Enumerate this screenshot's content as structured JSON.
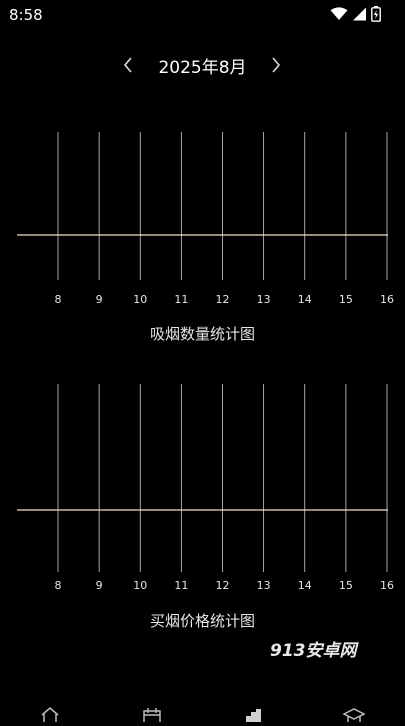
{
  "status": {
    "time": "8:58"
  },
  "header": {
    "month_title": "2025年8月"
  },
  "charts": [
    {
      "title": "吸烟数量统计图",
      "line_color": "#f2e0c8",
      "grid_color": "#cfcfcf",
      "ticks": [
        "8",
        "9",
        "10",
        "11",
        "12",
        "13",
        "14",
        "15",
        "16"
      ]
    },
    {
      "title": "买烟价格统计图",
      "line_color": "#f2e0c8",
      "grid_color": "#cfcfcf",
      "ticks": [
        "8",
        "9",
        "10",
        "11",
        "12",
        "13",
        "14",
        "15",
        "16"
      ]
    }
  ],
  "chart_data": [
    {
      "type": "line",
      "title": "吸烟数量统计图",
      "categories": [
        "8",
        "9",
        "10",
        "11",
        "12",
        "13",
        "14",
        "15",
        "16"
      ],
      "values": [
        0,
        0,
        0,
        0,
        0,
        0,
        0,
        0,
        0
      ],
      "grid": true
    },
    {
      "type": "line",
      "title": "买烟价格统计图",
      "categories": [
        "8",
        "9",
        "10",
        "11",
        "12",
        "13",
        "14",
        "15",
        "16"
      ],
      "values": [
        0,
        0,
        0,
        0,
        0,
        0,
        0,
        0,
        0
      ],
      "grid": true
    }
  ],
  "watermark": {
    "text": "913安卓网"
  },
  "bottom_nav": {
    "items": [
      {
        "icon": "home-icon"
      },
      {
        "icon": "calendar-icon"
      },
      {
        "icon": "chart-icon"
      },
      {
        "icon": "graduation-cap-icon"
      }
    ]
  },
  "icons": {
    "prev": "chevron-left-icon",
    "next": "chevron-right-icon",
    "wifi": "wifi-icon",
    "signal": "signal-icon",
    "battery": "battery-charging-icon"
  }
}
